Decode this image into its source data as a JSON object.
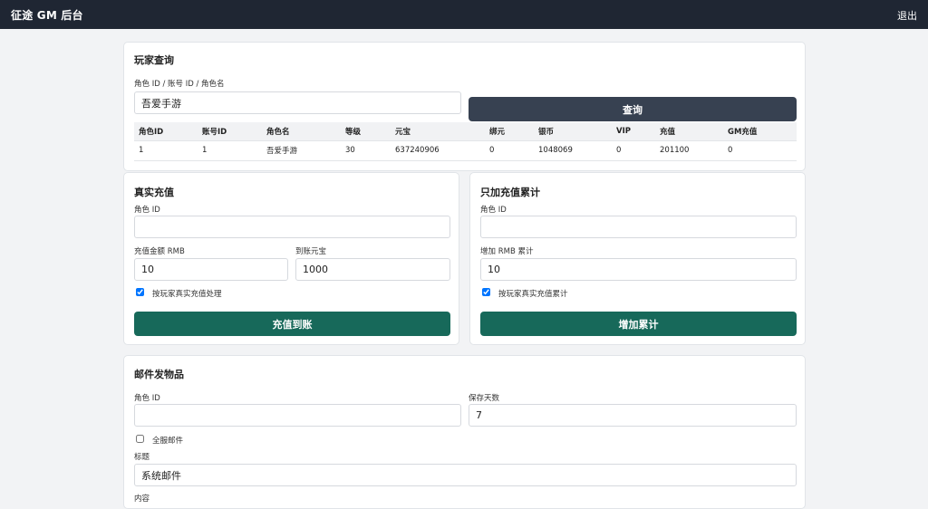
{
  "header": {
    "brand": "征途 GM 后台",
    "logout": "退出"
  },
  "query": {
    "title": "玩家查询",
    "label": "角色 ID / 账号 ID / 角色名",
    "value": "吾爱手游",
    "button": "查询",
    "columns": [
      "角色ID",
      "账号ID",
      "角色名",
      "等级",
      "元宝",
      "绑元",
      "银币",
      "VIP",
      "充值",
      "GM充值"
    ],
    "rows": [
      [
        "1",
        "1",
        "吾爱手游",
        "30",
        "637240906",
        "0",
        "1048069",
        "0",
        "201100",
        "0"
      ]
    ]
  },
  "recharge": {
    "title": "真实充值",
    "role_label": "角色 ID",
    "role_value": "",
    "amount_label": "充值金额 RMB",
    "amount_value": "10",
    "yuanbao_label": "到账元宝",
    "yuanbao_value": "1000",
    "checkbox_label": "按玩家真实充值处理",
    "checkbox_checked": true,
    "button": "充值到账"
  },
  "accumulate": {
    "title": "只加充值累计",
    "role_label": "角色 ID",
    "role_value": "",
    "amount_label": "增加 RMB 累计",
    "amount_value": "10",
    "checkbox_label": "按玩家真实充值累计",
    "checkbox_checked": true,
    "button": "增加累计"
  },
  "mail": {
    "title": "邮件发物品",
    "role_label": "角色 ID",
    "role_value": "",
    "days_label": "保存天数",
    "days_value": "7",
    "all_label": "全服邮件",
    "all_checked": false,
    "subject_label": "标题",
    "subject_value": "系统邮件",
    "content_label": "内容"
  }
}
